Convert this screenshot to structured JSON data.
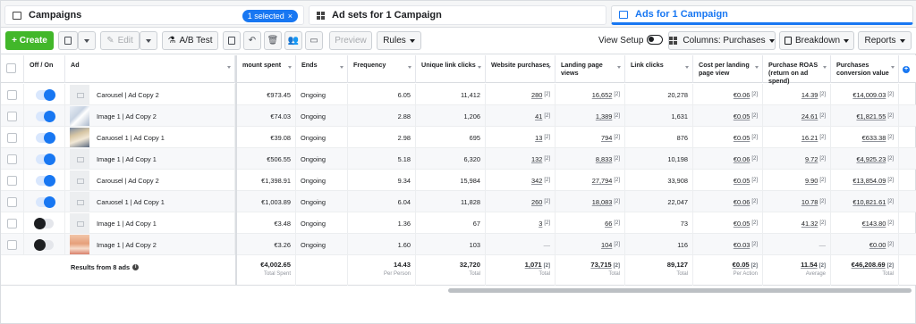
{
  "tabs": {
    "campaigns": "Campaigns",
    "selected": "1 selected",
    "ad_sets": "Ad sets for 1 Campaign",
    "ads": "Ads for 1 Campaign"
  },
  "toolbar": {
    "create": "+ Create",
    "edit": "Edit",
    "ab_test": "A/B Test",
    "preview": "Preview",
    "rules": "Rules",
    "view_setup": "View Setup",
    "columns": "Columns: Purchases",
    "breakdown": "Breakdown",
    "reports": "Reports"
  },
  "headers": {
    "off_on": "Off / On",
    "ad": "Ad",
    "amount_spent": "mount spent",
    "ends": "Ends",
    "frequency": "Frequency",
    "unique_link_clicks": "Unique link clicks",
    "website_purchases": "Website purchases",
    "landing_page_views": "Landing page views",
    "link_clicks": "Link clicks",
    "cost_per_lpv": "Cost per landing page view",
    "purchase_roas": "Purchase ROAS (return on ad spend)",
    "purchases_value": "Purchases conversion value"
  },
  "rows": [
    {
      "on": true,
      "thumb": "ph",
      "name": "Carousel | Ad Copy 2",
      "spent": "€973.45",
      "ends": "Ongoing",
      "freq": "6.05",
      "ulc": "11,412",
      "wp": "280",
      "lpv": "16,652",
      "lc": "20,278",
      "cplpv": "€0.06",
      "roas": "14.39",
      "value": "€14,009.03"
    },
    {
      "on": true,
      "thumb": "photo-a",
      "name": "Image 1 | Ad Copy 2",
      "spent": "€74.03",
      "ends": "Ongoing",
      "freq": "2.88",
      "ulc": "1,206",
      "wp": "41",
      "lpv": "1,389",
      "lc": "1,631",
      "cplpv": "€0.05",
      "roas": "24.61",
      "value": "€1,821.55"
    },
    {
      "on": true,
      "thumb": "photo-b",
      "name": "Caruosel 1 | Ad Copy 1",
      "spent": "€39.08",
      "ends": "Ongoing",
      "freq": "2.98",
      "ulc": "695",
      "wp": "13",
      "lpv": "794",
      "lc": "876",
      "cplpv": "€0.05",
      "roas": "16.21",
      "value": "€633.38"
    },
    {
      "on": true,
      "thumb": "ph",
      "name": "Image 1 | Ad Copy 1",
      "spent": "€506.55",
      "ends": "Ongoing",
      "freq": "5.18",
      "ulc": "6,320",
      "wp": "132",
      "lpv": "8,833",
      "lc": "10,198",
      "cplpv": "€0.06",
      "roas": "9.72",
      "value": "€4,925.23"
    },
    {
      "on": true,
      "thumb": "ph",
      "name": "Carousel | Ad Copy 2",
      "spent": "€1,398.91",
      "ends": "Ongoing",
      "freq": "9.34",
      "ulc": "15,984",
      "wp": "342",
      "lpv": "27,794",
      "lc": "33,908",
      "cplpv": "€0.05",
      "roas": "9.90",
      "value": "€13,854.09"
    },
    {
      "on": true,
      "thumb": "ph",
      "name": "Caruosel 1 | Ad Copy 1",
      "spent": "€1,003.89",
      "ends": "Ongoing",
      "freq": "6.04",
      "ulc": "11,828",
      "wp": "260",
      "lpv": "18,083",
      "lc": "22,047",
      "cplpv": "€0.06",
      "roas": "10.78",
      "value": "€10,821.61"
    },
    {
      "on": false,
      "thumb": "ph",
      "name": "Image 1 | Ad Copy 1",
      "spent": "€3.48",
      "ends": "Ongoing",
      "freq": "1.36",
      "ulc": "67",
      "wp": "3",
      "lpv": "66",
      "lc": "73",
      "cplpv": "€0.05",
      "roas": "41.32",
      "value": "€143.80"
    },
    {
      "on": false,
      "thumb": "photo-c",
      "name": "Image 1 | Ad Copy 2",
      "spent": "€3.26",
      "ends": "Ongoing",
      "freq": "1.60",
      "ulc": "103",
      "wp": "—",
      "lpv": "104",
      "lc": "116",
      "cplpv": "€0.03",
      "roas": "—",
      "value": "€0.00"
    }
  ],
  "ref": "[2]",
  "totals": {
    "label": "Results from 8 ads",
    "spent": "€4,002.65",
    "spent_sub": "Total Spent",
    "freq": "14.43",
    "freq_sub": "Per Person",
    "ulc": "32,720",
    "ulc_sub": "Total",
    "wp": "1,071",
    "wp_sub": "Total",
    "lpv": "73,715",
    "lpv_sub": "Total",
    "lc": "89,127",
    "lc_sub": "Total",
    "cplpv": "€0.05",
    "cplpv_sub": "Per Action",
    "roas": "11.54",
    "roas_sub": "Average",
    "value": "€46,208.69",
    "value_sub": "Total"
  }
}
